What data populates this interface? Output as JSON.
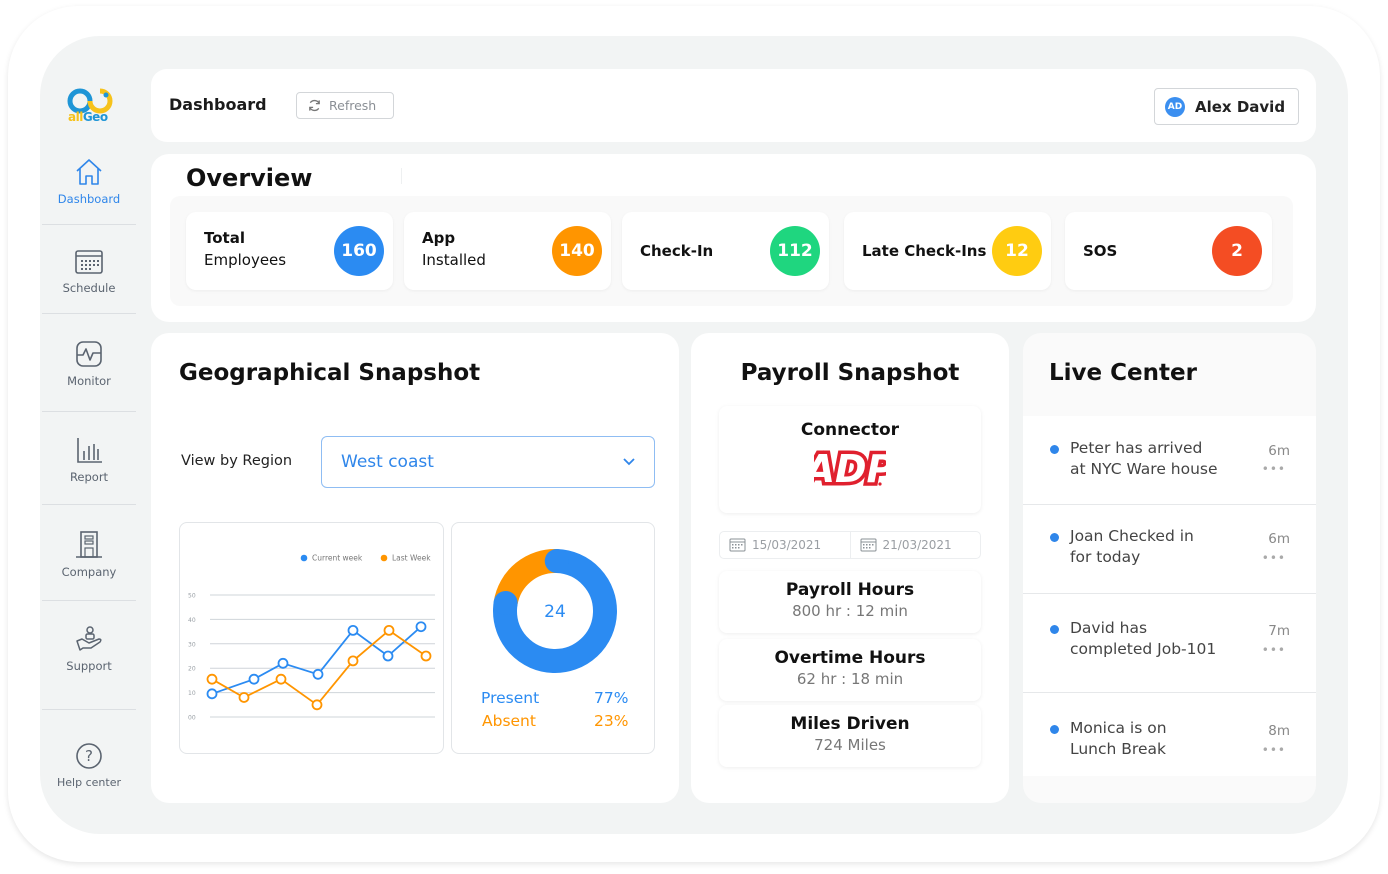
{
  "brand": {
    "name_part1": "all",
    "name_part2": "Geo"
  },
  "sidebar": {
    "items": [
      {
        "label": "Dashboard",
        "icon": "home-icon",
        "active": true
      },
      {
        "label": "Schedule",
        "icon": "calendar-icon"
      },
      {
        "label": "Monitor",
        "icon": "heartbeat-monitor-icon"
      },
      {
        "label": "Report",
        "icon": "bar-chart-icon"
      },
      {
        "label": "Company",
        "icon": "building-icon"
      },
      {
        "label": "Support",
        "icon": "support-hand-icon"
      },
      {
        "label": "Help center",
        "icon": "help-circle-icon"
      }
    ]
  },
  "header": {
    "title": "Dashboard",
    "refresh_label": "Refresh",
    "user": {
      "initials": "AD",
      "name": "Alex David"
    }
  },
  "overview": {
    "title": "Overview",
    "stats": [
      {
        "line1": "Total",
        "line2": "Employees",
        "value": "160",
        "color": "#2b8bf2"
      },
      {
        "line1": "App",
        "line2": "Installed",
        "value": "140",
        "color": "#ff9500"
      },
      {
        "line1": "Check-In",
        "line2": "",
        "value": "112",
        "color": "#1fd67f"
      },
      {
        "line1": "Late Check-Ins",
        "line2": "",
        "value": "12",
        "color": "#ffcc11"
      },
      {
        "line1": "SOS",
        "line2": "",
        "value": "2",
        "color": "#f44d23"
      }
    ]
  },
  "geo": {
    "title": "Geographical Snapshot",
    "region_label": "View by Region",
    "region_value": "West coast",
    "donut": {
      "center_value": "24",
      "present_label": "Present",
      "present_pct": "77%",
      "absent_label": "Absent",
      "absent_pct": "23%"
    }
  },
  "chart_data": [
    {
      "type": "line",
      "title": "",
      "xlabel": "",
      "ylabel": "",
      "ylim": [
        0,
        50
      ],
      "yticks": [
        "00",
        "10",
        "20",
        "30",
        "40",
        "50"
      ],
      "grid": true,
      "legend": "top-right",
      "x": [
        1,
        2,
        3,
        4,
        5,
        6,
        7
      ],
      "series": [
        {
          "name": "Current week",
          "color": "#2b8bf2",
          "values": [
            9.5,
            15.5,
            22,
            17.5,
            35.5,
            25,
            37
          ]
        },
        {
          "name": "Last Week",
          "color": "#ff9500",
          "values": [
            15.5,
            8,
            15.5,
            5,
            23,
            35.5,
            25
          ]
        }
      ]
    },
    {
      "type": "pie",
      "title": "",
      "center_label": "24",
      "categories": [
        "Present",
        "Absent"
      ],
      "values": [
        77,
        23
      ],
      "colors": [
        "#2b8bf2",
        "#ff9500"
      ]
    }
  ],
  "payroll": {
    "title": "Payroll Snapshot",
    "connector_label": "Connector",
    "connector_logo": "ADP",
    "date_from": "15/03/2021",
    "date_to": "21/03/2021",
    "metrics": [
      {
        "label": "Payroll Hours",
        "value": "800 hr : 12 min"
      },
      {
        "label": "Overtime Hours",
        "value": "62 hr : 18 min"
      },
      {
        "label": "Miles Driven",
        "value": "724 Miles"
      }
    ]
  },
  "live": {
    "title": "Live Center",
    "items": [
      {
        "line1": "Peter has arrived",
        "line2": "at NYC Ware house",
        "time": "6m"
      },
      {
        "line1": "Joan Checked in",
        "line2": "for today",
        "time": "6m"
      },
      {
        "line1": "David has",
        "line2": "completed Job-101",
        "time": "7m"
      },
      {
        "line1": "Monica is on",
        "line2": "Lunch Break",
        "time": "8m"
      }
    ],
    "more_glyph": "•••"
  }
}
